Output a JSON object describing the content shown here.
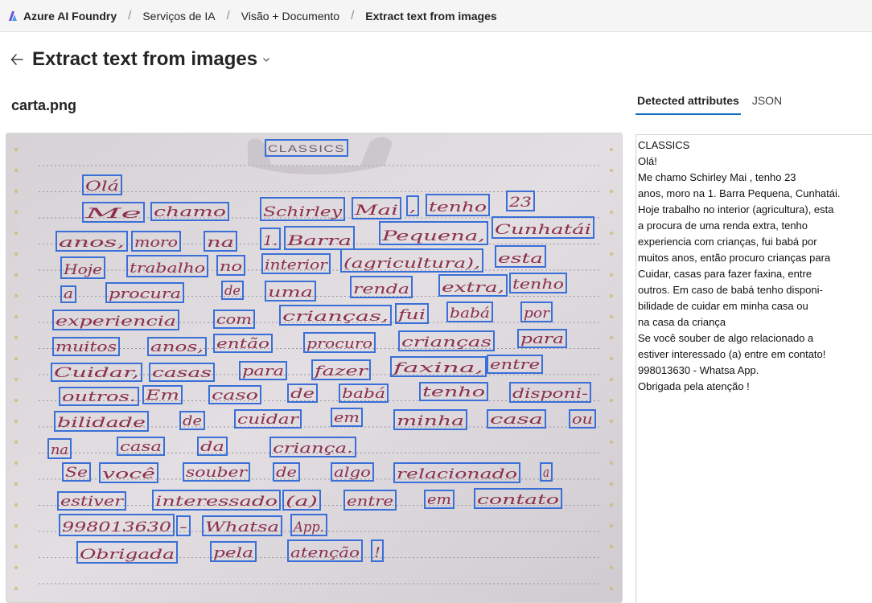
{
  "breadcrumb": {
    "brand": "Azure AI Foundry",
    "items": [
      "Serviços de IA",
      "Visão + Documento",
      "Extract text from images"
    ]
  },
  "header": {
    "title": "Extract text from images"
  },
  "file": {
    "name": "carta.png"
  },
  "tabs": {
    "detected": "Detected attributes",
    "json": "JSON"
  },
  "colors": {
    "accent": "#0f6cbd",
    "box": "#3a6fd8",
    "ink": "#8c2f4a"
  },
  "icons": {
    "logo": "azure-ai-foundry-logo",
    "back": "arrow-left-icon",
    "dropdown": "chevron-down-icon"
  },
  "image": {
    "heading": "CLASSICS",
    "words": [
      "CLASSICS",
      "Olá",
      "Me",
      "chamo",
      "Schirley",
      "Mai",
      ",",
      "tenho",
      "23",
      "anos,",
      "moro",
      "na",
      "1.",
      "Barra",
      "Pequena,",
      "Cunhatái",
      "Hoje",
      "trabalho",
      "no",
      "interior",
      "(agricultura),",
      "esta",
      "a",
      "procura",
      "de",
      "uma",
      "renda",
      "extra,",
      "tenho",
      "experiencia",
      "com",
      "crianças,",
      "fui",
      "babá",
      "por",
      "muitos",
      "anos,",
      "então",
      "procuro",
      "crianças",
      "para",
      "Cuidar,",
      "casas",
      "para",
      "fazer",
      "faxina,",
      "entre",
      "outros.",
      "Em",
      "caso",
      "de",
      "babá",
      "tenho",
      "disponi-",
      "bilidade",
      "de",
      "cuidar",
      "em",
      "minha",
      "casa",
      "ou",
      "na",
      "casa",
      "da",
      "criança.",
      "Se",
      "você",
      "souber",
      "de",
      "algo",
      "relacionado",
      "a",
      "estiver",
      "interessado",
      "(a)",
      "entre",
      "em",
      "contato",
      "998013630",
      "-",
      "Whatsa",
      "App.",
      "Obrigada",
      "pela",
      "atenção",
      "!"
    ]
  },
  "result": {
    "lines": [
      "CLASSICS",
      "Olá!",
      "Me chamo Schirley Mai , tenho 23",
      "anos, moro na 1. Barra Pequena, Cunhatái.",
      "Hoje trabalho no interior (agricultura), esta",
      "a procura de uma renda extra, tenho",
      "experiencia com crianças, fui babá por",
      "muitos anos, então procuro crianças para",
      "Cuidar, casas para fazer faxina, entre",
      "outros. Em caso de babá tenho disponi-",
      "bilidade de cuidar em minha casa ou",
      "na casa da criança",
      "Se você souber de algo relacionado a",
      "estiver interessado (a) entre em contato!",
      "998013630 - Whatsa App.",
      "Obrigada pela atenção !"
    ]
  }
}
